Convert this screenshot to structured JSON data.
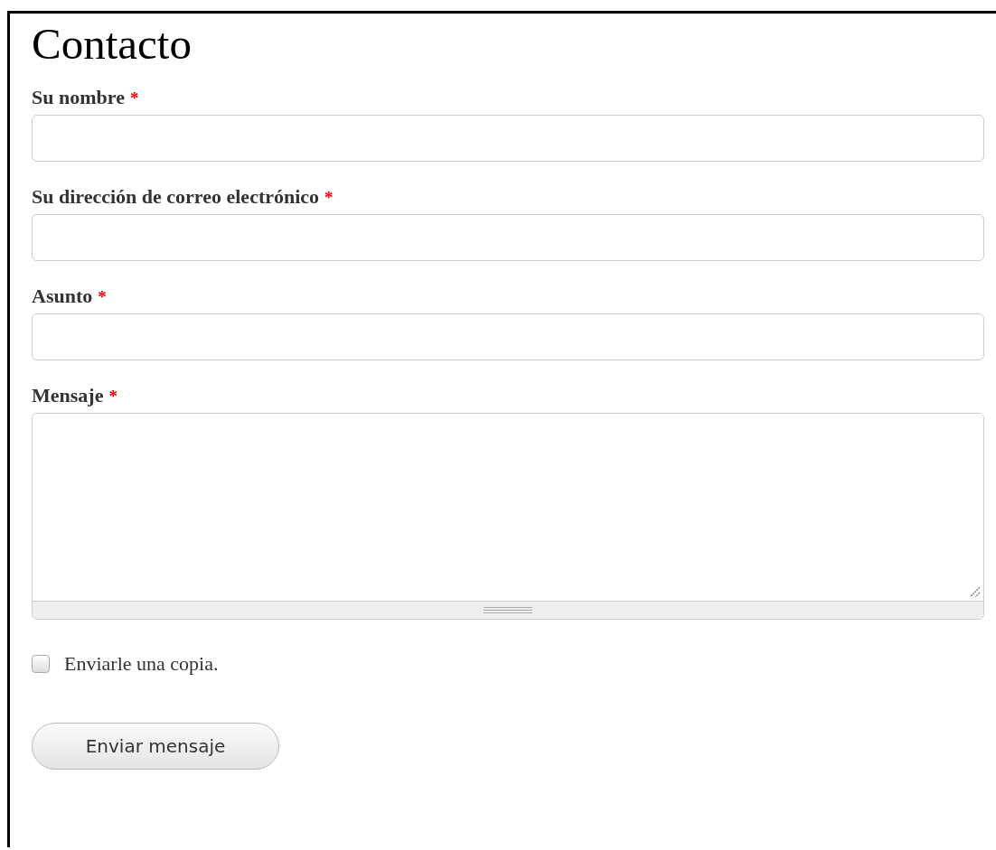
{
  "page": {
    "title": "Contacto"
  },
  "fields": [
    {
      "kind": "text",
      "label": "Su nombre",
      "required": true,
      "required_mark": "*"
    },
    {
      "kind": "text",
      "label": "Su dirección de correo electrónico",
      "required": true,
      "required_mark": "*"
    },
    {
      "kind": "text",
      "label": "Asunto",
      "required": true,
      "required_mark": "*"
    },
    {
      "kind": "textarea",
      "label": "Mensaje",
      "required": true,
      "required_mark": "*"
    }
  ],
  "copy_checkbox": {
    "label": "Enviarle una copia.",
    "checked": false
  },
  "submit_button": {
    "label": "Enviar mensaje"
  }
}
